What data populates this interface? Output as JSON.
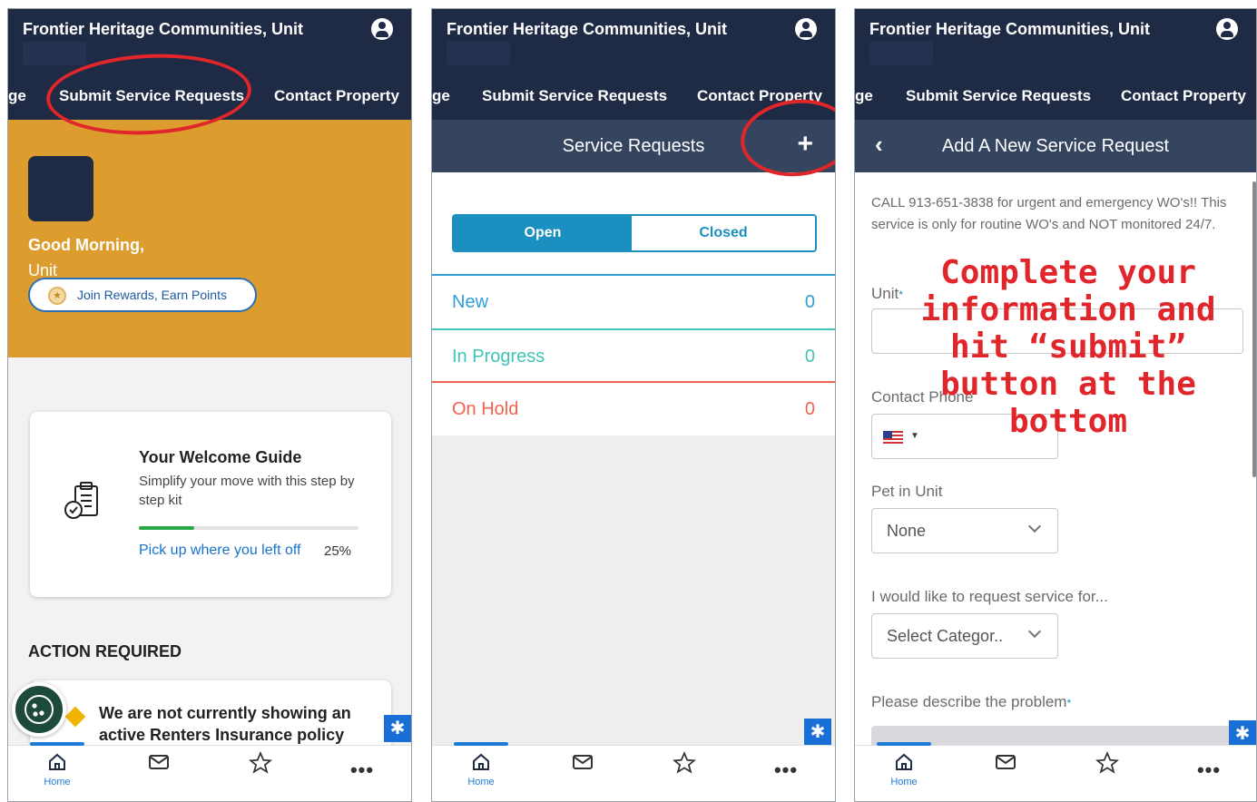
{
  "app": {
    "title": "Frontier Heritage Communities, Unit"
  },
  "tabs": {
    "partial": "ge",
    "submit": "Submit Service Requests",
    "contact": "Contact Property"
  },
  "home": {
    "greeting": "Good Morning,",
    "unit": "Unit",
    "rewards_label": "Join Rewards, Earn Points",
    "guide": {
      "title": "Your Welcome Guide",
      "subtitle": "Simplify your move with this step by step kit",
      "link": "Pick up where you left off",
      "progress_text": "25%",
      "progress": 0.25
    },
    "action_header": "ACTION REQUIRED",
    "alert": "We are not currently showing an active Renters Insurance policy"
  },
  "service_requests": {
    "title": "Service Requests",
    "add_symbol": "+",
    "segments": [
      "Open",
      "Closed"
    ],
    "rows": [
      {
        "label": "New",
        "count": "0",
        "color": "#2f9fd8"
      },
      {
        "label": "In Progress",
        "count": "0",
        "color": "#3ec5b5"
      },
      {
        "label": "On Hold",
        "count": "0",
        "color": "#f0634f"
      }
    ]
  },
  "new_request": {
    "title": "Add A New Service Request",
    "notice": "CALL 913-651-3838 for urgent and emergency WO's!! This service is only for routine WO's and NOT monitored 24/7.",
    "unit_label": "Unit",
    "required_mark": "*",
    "phone_label": "Contact Phone",
    "pet_label": "Pet in Unit",
    "pet_value": "None",
    "service_label": "I would like to request service for...",
    "category_placeholder": "Select Categor..",
    "problem_label": "Please describe the problem"
  },
  "annotation": {
    "text": "Complete your information and hit “submit” button at the bottom"
  },
  "nav": {
    "home_label": "Home",
    "icons": [
      "home-icon",
      "mail-icon",
      "star-icon",
      "more-icon"
    ]
  },
  "colors": {
    "navy": "#1f2a44",
    "gold": "#dc9d2e",
    "accent_blue": "#1b8fc0",
    "annotation_red": "#e0262b"
  }
}
